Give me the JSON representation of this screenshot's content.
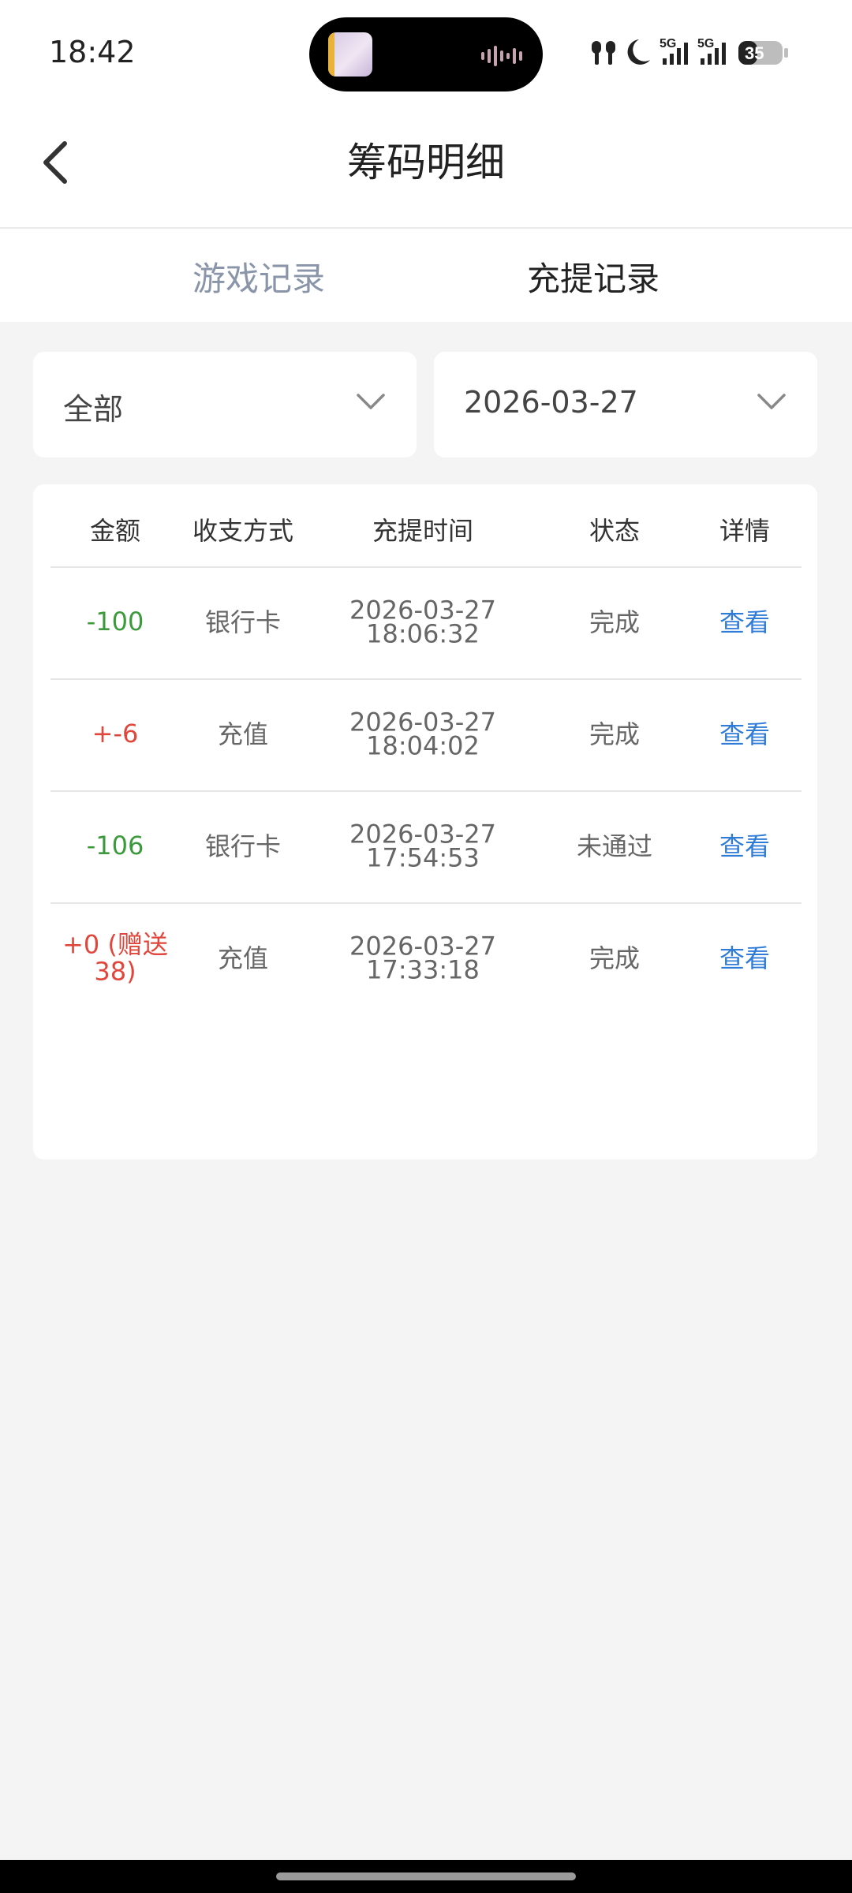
{
  "status_bar": {
    "time": "18:42",
    "battery": "35",
    "network_1": "5G",
    "network_2": "5G",
    "icons": [
      "earbuds-icon",
      "moon-icon",
      "signal-icon",
      "signal-icon",
      "battery-icon"
    ]
  },
  "header": {
    "title": "筹码明细"
  },
  "tabs": [
    {
      "label": "游戏记录",
      "active": false
    },
    {
      "label": "充提记录",
      "active": true
    }
  ],
  "filters": {
    "type": "全部",
    "date": "2026-03-27"
  },
  "table": {
    "columns": [
      "金额",
      "收支方式",
      "充提时间",
      "状态",
      "详情"
    ],
    "rows": [
      {
        "amount": "-100",
        "method": "银行卡",
        "date": "2026-03-27",
        "time": "18:06:32",
        "status": "完成",
        "detail": "查看"
      },
      {
        "amount": "+-6",
        "method": "充值",
        "date": "2026-03-27",
        "time": "18:04:02",
        "status": "完成",
        "detail": "查看"
      },
      {
        "amount": "-106",
        "method": "银行卡",
        "date": "2026-03-27",
        "time": "17:54:53",
        "status": "未通过",
        "detail": "查看"
      },
      {
        "amount": "+0 (赠送38)",
        "method": "充值",
        "date": "2026-03-27",
        "time": "17:33:18",
        "status": "完成",
        "detail": "查看"
      }
    ]
  },
  "colors": {
    "negative": "#3c9a3c",
    "positive": "#e0463b",
    "link": "#2e7bd8",
    "background": "#f4f4f4"
  }
}
